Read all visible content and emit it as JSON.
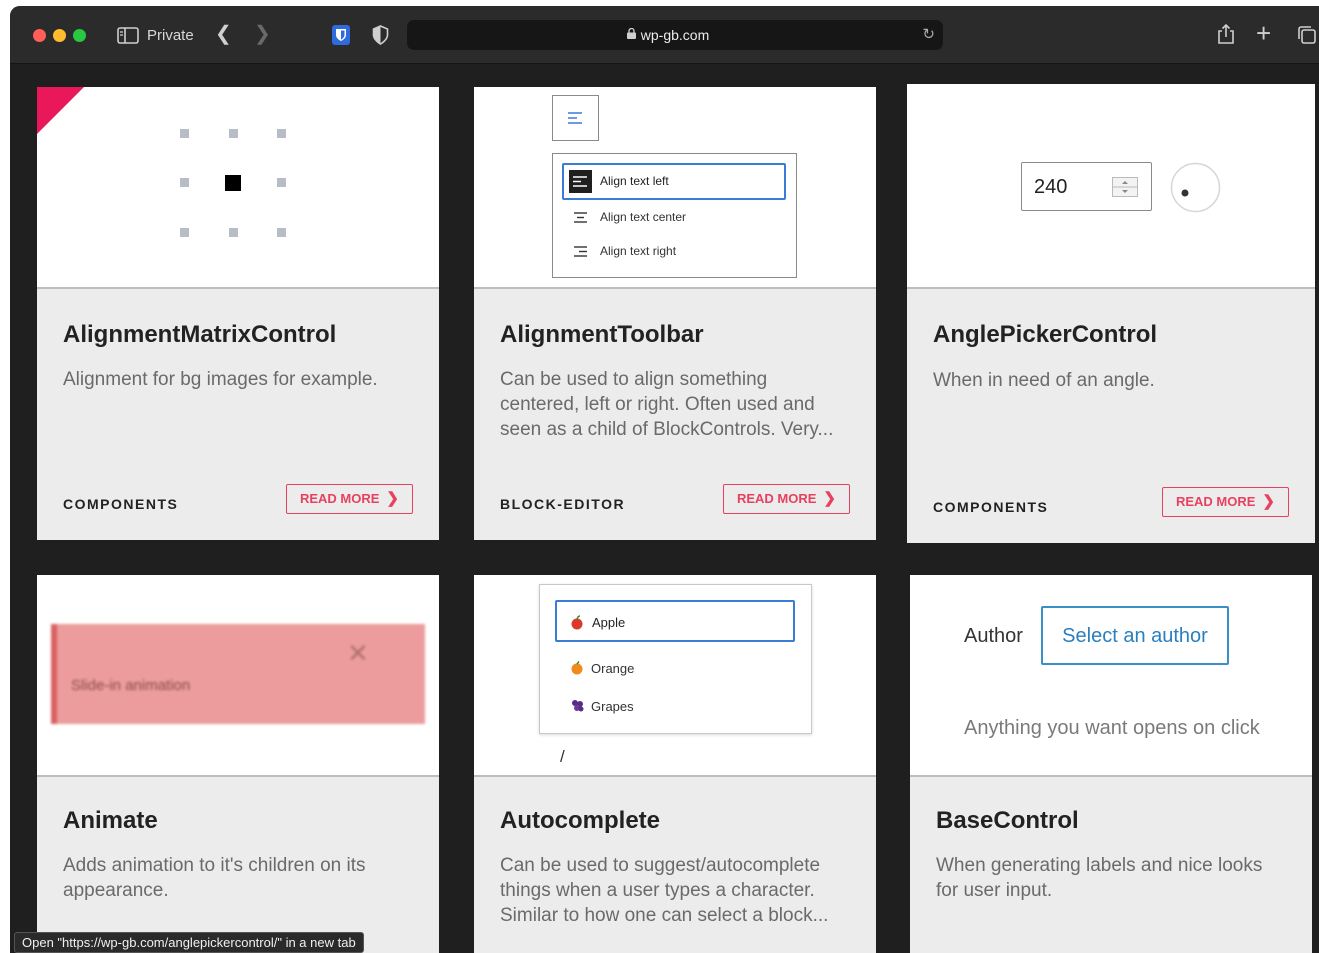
{
  "browser": {
    "private_label": "Private",
    "url": "wp-gb.com",
    "colors": {
      "close": "#ff5f57",
      "minimize": "#febc2e",
      "zoom": "#28c840"
    }
  },
  "cards": [
    {
      "title": "AlignmentMatrixControl",
      "description": "Alignment for bg images for example.",
      "category": "COMPONENTS",
      "read_more": "READ MORE"
    },
    {
      "title": "AlignmentToolbar",
      "description": "Can be used to align something centered, left or right. Often used and seen as a child of BlockControls. Very...",
      "category": "BLOCK-EDITOR",
      "read_more": "READ MORE",
      "preview": {
        "items": [
          "Align text left",
          "Align text center",
          "Align text right"
        ]
      }
    },
    {
      "title": "AnglePickerControl",
      "description": "When in need of an angle.",
      "category": "COMPONENTS",
      "read_more": "READ MORE",
      "preview": {
        "value": "240"
      }
    },
    {
      "title": "Animate",
      "description": "Adds animation to it's children on its appearance.",
      "preview": {
        "notice": "Slide-in animation"
      }
    },
    {
      "title": "Autocomplete",
      "description": "Can be used to suggest/autocomplete things when a user types a character. Similar to how one can select a block...",
      "preview": {
        "options": [
          "Apple",
          "Orange",
          "Grapes"
        ],
        "typed": "/"
      }
    },
    {
      "title": "BaseControl",
      "description": "When generating labels and nice looks for user input.",
      "preview": {
        "label": "Author",
        "button": "Select an author",
        "caption": "Anything you want opens on click"
      }
    }
  ],
  "status_bar": "Open \"https://wp-gb.com/anglepickercontrol/\" in a new tab"
}
